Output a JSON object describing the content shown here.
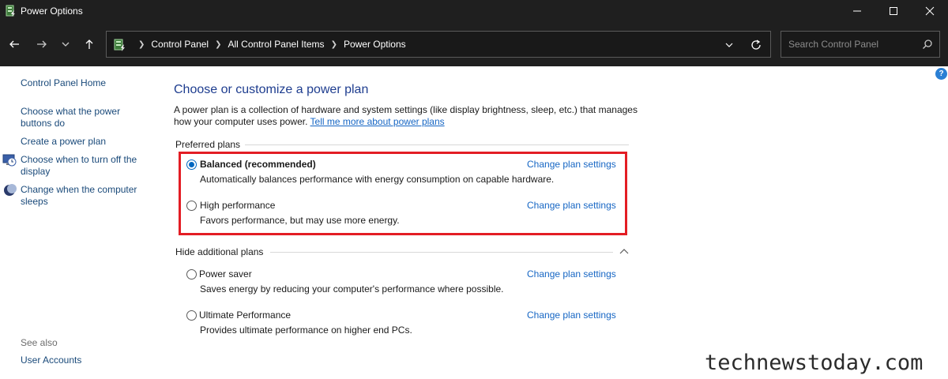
{
  "window": {
    "title": "Power Options",
    "icon": "power-options-icon",
    "controls": [
      "minimize-icon",
      "maximize-icon",
      "close-icon"
    ]
  },
  "navigation": {
    "buttons": [
      "back-arrow-icon",
      "forward-arrow-icon",
      "recent-locations-chevron-icon",
      "up-arrow-icon"
    ],
    "breadcrumb": [
      "Control Panel",
      "All Control Panel Items",
      "Power Options"
    ],
    "search_placeholder": "Search Control Panel"
  },
  "sidebar": {
    "home": "Control Panel Home",
    "tasks": [
      {
        "label": "Choose what the power buttons do",
        "icon": null
      },
      {
        "label": "Create a power plan",
        "icon": null
      },
      {
        "label": "Choose when to turn off the display",
        "icon": "display-clock-icon"
      },
      {
        "label": "Change when the computer sleeps",
        "icon": "moon-sleep-icon"
      }
    ],
    "see_also_label": "See also",
    "see_also": [
      "User Accounts"
    ]
  },
  "main": {
    "title": "Choose or customize a power plan",
    "description": "A power plan is a collection of hardware and system settings (like display brightness, sleep, etc.) that manages how your computer uses power.",
    "learn_more_link": "Tell me more about power plans",
    "preferred_label": "Preferred plans",
    "preferred_plans": [
      {
        "name": "Balanced (recommended)",
        "description": "Automatically balances performance with energy consumption on capable hardware.",
        "selected": true,
        "link": "Change plan settings"
      },
      {
        "name": "High performance",
        "description": "Favors performance, but may use more energy.",
        "selected": false,
        "link": "Change plan settings"
      }
    ],
    "additional_label": "Hide additional plans",
    "additional_plans": [
      {
        "name": "Power saver",
        "description": "Saves energy by reducing your computer's performance where possible.",
        "selected": false,
        "link": "Change plan settings"
      },
      {
        "name": "Ultimate Performance",
        "description": "Provides ultimate performance on higher end PCs.",
        "selected": false,
        "link": "Change plan settings"
      }
    ]
  },
  "watermark": "technewstoday.com",
  "colors": {
    "titlebar": "#1f1f1f",
    "heading": "#1e3d8f",
    "link": "#1666c4",
    "highlight": "#e31d24",
    "radio_selected": "#0067c0"
  }
}
